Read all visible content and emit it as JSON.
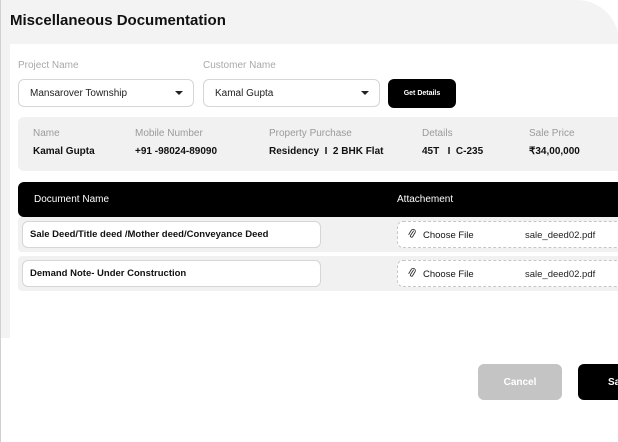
{
  "dialog": {
    "title": "Miscellaneous Documentation"
  },
  "form": {
    "project_label": "Project Name",
    "project_value": "Mansarover Township",
    "customer_label": "Customer Name",
    "customer_value": "Kamal Gupta",
    "get_details_label": "Get Details"
  },
  "info": {
    "name_label": "Name",
    "name_value": "Kamal Gupta",
    "mobile_label": "Mobile Number",
    "mobile_value": "+91 -98024-89090",
    "property_label": "Property Purchase",
    "property_value": "Residency  I  2 BHK Flat",
    "details_label": "Details",
    "details_value": "45T   I  C-235",
    "price_label": "Sale Price",
    "price_value": "₹34,00,000"
  },
  "table": {
    "col_document": "Document Name",
    "col_attachment": "Attachement",
    "rows": [
      {
        "document": "Sale Deed/Title deed /Mother deed/Conveyance Deed",
        "choose": "Choose File",
        "file": "sale_deed02.pdf"
      },
      {
        "document": "Demand Note- Under Construction",
        "choose": "Choose File",
        "file": "sale_deed02.pdf"
      }
    ]
  },
  "actions": {
    "cancel_label": "Cancel",
    "save_label": "Save"
  },
  "icons": {
    "dropdown": "chevron-down-icon",
    "attachment": "paperclip-icon"
  },
  "colors": {
    "primary": "#000000",
    "disabled": "#c4c4c4",
    "panel": "#f1f1f1"
  }
}
